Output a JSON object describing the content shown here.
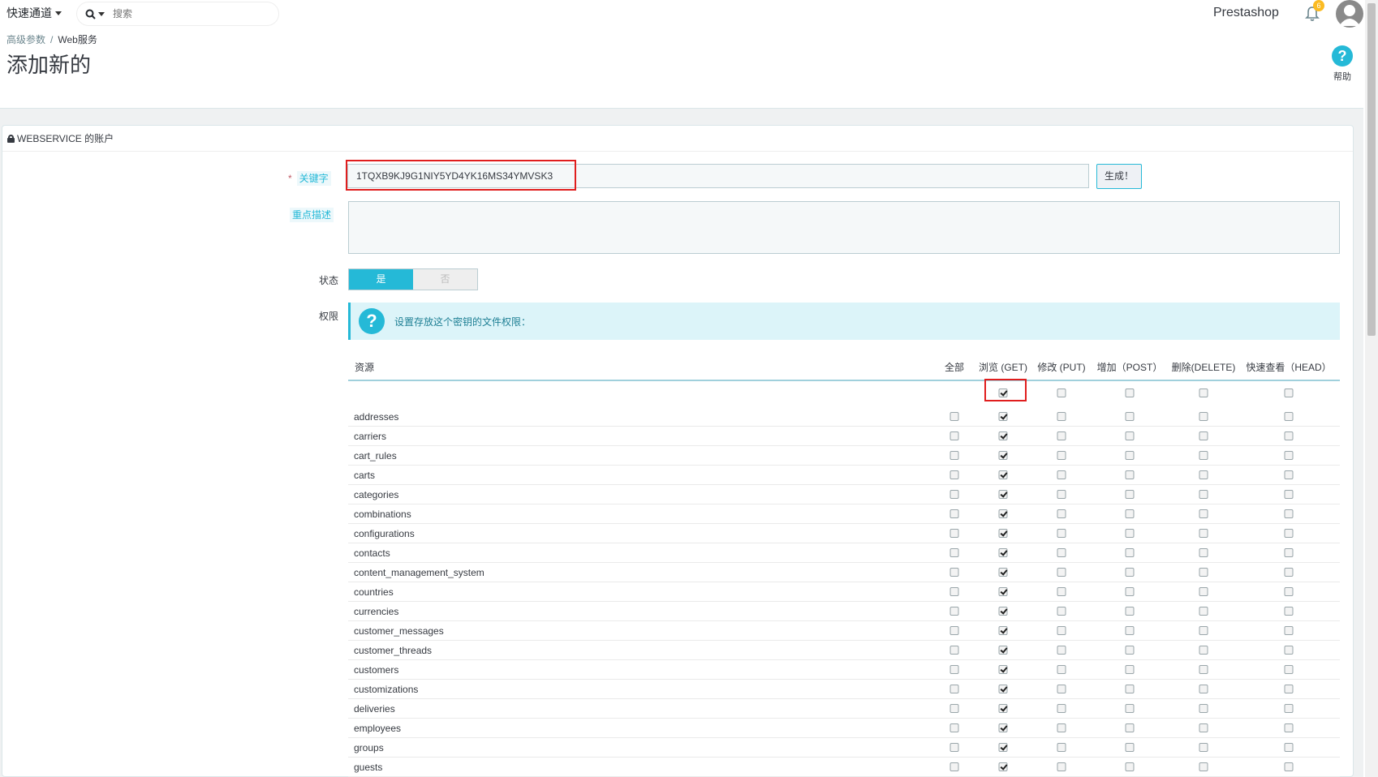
{
  "header": {
    "quick_access": "快速通道",
    "search_placeholder": "搜索",
    "shop_name": "Prestashop",
    "notifications_count": "6"
  },
  "breadcrumb": {
    "parent": "高级参数",
    "separator": "/",
    "current": "Web服务"
  },
  "page_title": "添加新的",
  "help_label": "帮助",
  "panel_title": "WEBSERVICE 的账户",
  "form": {
    "key_label": "关键字",
    "required_mark": "*",
    "key_value": "1TQXB9KJ9G1NIY5YD4YK16MS34YMVSK3",
    "generate_label": "生成！",
    "description_label": "重点描述",
    "description_value": "",
    "status_label": "状态",
    "status_yes": "是",
    "status_no": "否",
    "status_value": "是",
    "permissions_label": "权限",
    "permissions_info": "设置存放这个密钥的文件权限："
  },
  "table": {
    "headers": [
      "资源",
      "全部",
      "浏览 (GET)",
      "修改 (PUT)",
      "增加（POST）",
      "删除(DELETE)",
      "快速查看（HEAD）"
    ],
    "select_all_row": [
      false,
      true,
      false,
      false,
      false,
      false
    ],
    "resources": [
      {
        "name": "addresses",
        "perms": [
          false,
          true,
          false,
          false,
          false,
          false
        ]
      },
      {
        "name": "carriers",
        "perms": [
          false,
          true,
          false,
          false,
          false,
          false
        ]
      },
      {
        "name": "cart_rules",
        "perms": [
          false,
          true,
          false,
          false,
          false,
          false
        ]
      },
      {
        "name": "carts",
        "perms": [
          false,
          true,
          false,
          false,
          false,
          false
        ]
      },
      {
        "name": "categories",
        "perms": [
          false,
          true,
          false,
          false,
          false,
          false
        ]
      },
      {
        "name": "combinations",
        "perms": [
          false,
          true,
          false,
          false,
          false,
          false
        ]
      },
      {
        "name": "configurations",
        "perms": [
          false,
          true,
          false,
          false,
          false,
          false
        ]
      },
      {
        "name": "contacts",
        "perms": [
          false,
          true,
          false,
          false,
          false,
          false
        ]
      },
      {
        "name": "content_management_system",
        "perms": [
          false,
          true,
          false,
          false,
          false,
          false
        ]
      },
      {
        "name": "countries",
        "perms": [
          false,
          true,
          false,
          false,
          false,
          false
        ]
      },
      {
        "name": "currencies",
        "perms": [
          false,
          true,
          false,
          false,
          false,
          false
        ]
      },
      {
        "name": "customer_messages",
        "perms": [
          false,
          true,
          false,
          false,
          false,
          false
        ]
      },
      {
        "name": "customer_threads",
        "perms": [
          false,
          true,
          false,
          false,
          false,
          false
        ]
      },
      {
        "name": "customers",
        "perms": [
          false,
          true,
          false,
          false,
          false,
          false
        ]
      },
      {
        "name": "customizations",
        "perms": [
          false,
          true,
          false,
          false,
          false,
          false
        ]
      },
      {
        "name": "deliveries",
        "perms": [
          false,
          true,
          false,
          false,
          false,
          false
        ]
      },
      {
        "name": "employees",
        "perms": [
          false,
          true,
          false,
          false,
          false,
          false
        ]
      },
      {
        "name": "groups",
        "perms": [
          false,
          true,
          false,
          false,
          false,
          false
        ]
      },
      {
        "name": "guests",
        "perms": [
          false,
          true,
          false,
          false,
          false,
          false
        ]
      }
    ]
  },
  "colors": {
    "accent": "#25b9d7",
    "highlight": "#e01e1e"
  }
}
